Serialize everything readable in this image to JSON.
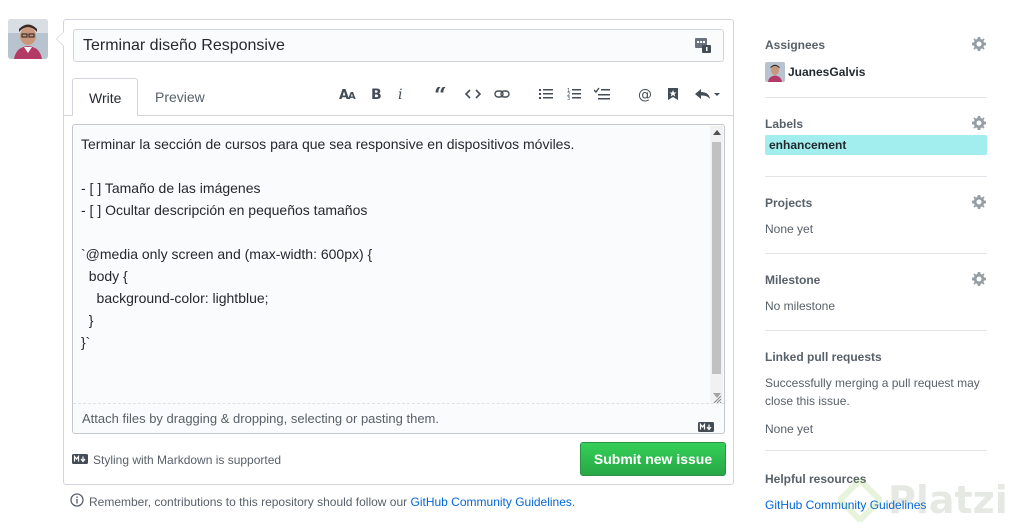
{
  "issue": {
    "title_value": "Terminar diseño Responsive",
    "tabs": [
      {
        "label": "Write"
      },
      {
        "label": "Preview"
      }
    ],
    "toolbar_icons": [
      "text-size-icon",
      "bold-icon",
      "italic-icon",
      "quote-icon",
      "code-icon",
      "link-icon",
      "bullet-list-icon",
      "numbered-list-icon",
      "task-list-icon",
      "mention-icon",
      "reference-icon",
      "reply-icon"
    ],
    "body_text": "Terminar la sección de cursos para que sea responsive en dispositivos móviles.\n\n- [ ] Tamaño de las imágenes\n- [ ] Ocultar descripción en pequeños tamaños\n\n`@media only screen and (max-width: 600px) {\n  body {\n    background-color: lightblue;\n  }\n}`",
    "attach_text": "Attach files by dragging & dropping, selecting or pasting them.",
    "markdown_note": "Styling with Markdown is supported",
    "submit_label": "Submit new issue",
    "remember_text": "Remember, contributions to this repository should follow our ",
    "remember_link": "GitHub Community Guidelines",
    "remember_end": "."
  },
  "sidebar": {
    "assignees": {
      "heading": "Assignees",
      "user": "JuanesGalvis"
    },
    "labels": {
      "heading": "Labels",
      "label": "enhancement",
      "color": "#a2eeef"
    },
    "projects": {
      "heading": "Projects",
      "value": "None yet"
    },
    "milestone": {
      "heading": "Milestone",
      "value": "No milestone"
    },
    "linked_prs": {
      "heading": "Linked pull requests",
      "description": "Successfully merging a pull request may close this issue.",
      "value": "None yet"
    },
    "helpful": {
      "heading": "Helpful resources",
      "link": "GitHub Community Guidelines"
    }
  },
  "watermark": {
    "text": "Platzi"
  },
  "colors": {
    "submit": "#2ea44f",
    "link": "#0366d6",
    "label": "#a2eeef"
  }
}
